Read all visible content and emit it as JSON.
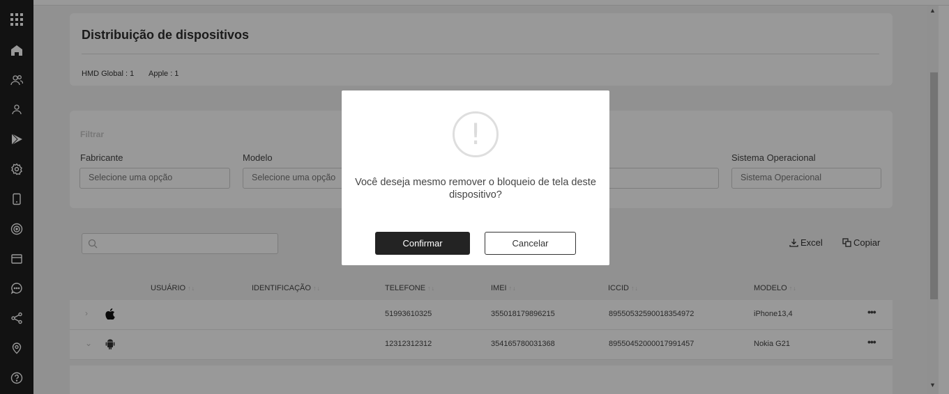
{
  "sidebar": {
    "icons": [
      "apps-grid-icon",
      "home-icon",
      "users-group-icon",
      "user-icon",
      "play-store-icon",
      "settings-gear-icon",
      "device-icon",
      "radar-icon",
      "browser-window-icon",
      "chat-icon",
      "share-icon",
      "location-pin-icon",
      "help-icon"
    ]
  },
  "distribution": {
    "title": "Distribuição de dispositivos",
    "items": [
      "HMD Global : 1",
      "Apple : 1"
    ]
  },
  "filter": {
    "title": "Filtrar",
    "fields": [
      {
        "label": "Fabricante",
        "placeholder": "Selecione uma opção"
      },
      {
        "label": "Modelo",
        "placeholder": "Selecione uma opção"
      },
      {
        "label": "Sistema Operacional",
        "placeholder": "Sistema Operacional"
      }
    ]
  },
  "toolbar": {
    "excel_label": "Excel",
    "copy_label": "Copiar"
  },
  "table": {
    "columns": [
      "USUÁRIO",
      "IDENTIFICAÇÃO",
      "TELEFONE",
      "IMEI",
      "ICCID",
      "MODELO"
    ],
    "rows": [
      {
        "os": "apple-icon",
        "user": "",
        "id": "",
        "phone": "51993610325",
        "imei": "355018179896215",
        "iccid": "89550532590018354972",
        "model": "iPhone13,4"
      },
      {
        "os": "android-icon",
        "user": "",
        "id": "",
        "phone": "12312312312",
        "imei": "354165780031368",
        "iccid": "89550452000017991457",
        "model": "Nokia G21"
      }
    ]
  },
  "modal": {
    "icon": "!",
    "message": "Você deseja mesmo remover o bloqueio de tela deste dispositivo?",
    "confirm_label": "Confirmar",
    "cancel_label": "Cancelar"
  }
}
